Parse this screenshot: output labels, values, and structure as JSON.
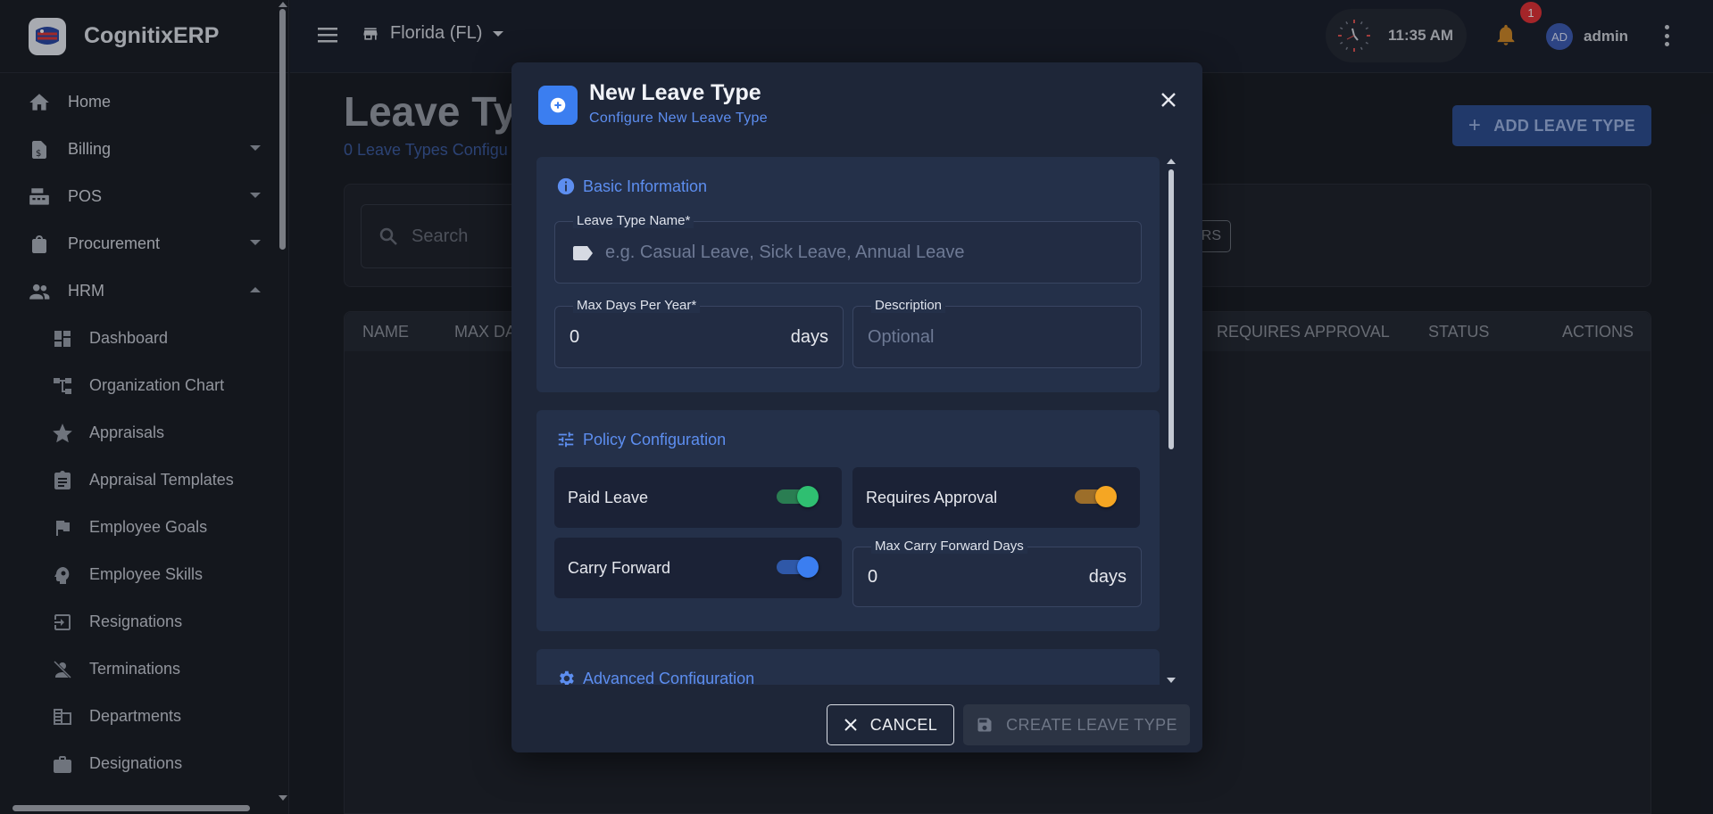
{
  "app": {
    "name": "CognitixERP"
  },
  "sidebar": {
    "items": [
      {
        "label": "Home",
        "icon": "home-icon"
      },
      {
        "label": "Billing",
        "icon": "billing-icon",
        "expandable": true
      },
      {
        "label": "POS",
        "icon": "pos-icon",
        "expandable": true
      },
      {
        "label": "Procurement",
        "icon": "bag-icon",
        "expandable": true
      },
      {
        "label": "HRM",
        "icon": "people-icon",
        "expanded": true
      }
    ],
    "hrm_items": [
      {
        "label": "Dashboard",
        "icon": "dashboard-icon"
      },
      {
        "label": "Organization Chart",
        "icon": "org-chart-icon"
      },
      {
        "label": "Appraisals",
        "icon": "star-icon"
      },
      {
        "label": "Appraisal Templates",
        "icon": "clipboard-icon"
      },
      {
        "label": "Employee Goals",
        "icon": "flag-icon"
      },
      {
        "label": "Employee Skills",
        "icon": "brain-icon"
      },
      {
        "label": "Resignations",
        "icon": "exit-icon"
      },
      {
        "label": "Terminations",
        "icon": "person-off-icon"
      },
      {
        "label": "Departments",
        "icon": "building-icon"
      },
      {
        "label": "Designations",
        "icon": "briefcase-icon"
      }
    ]
  },
  "topbar": {
    "store": "Florida (FL)",
    "time": "11:35 AM",
    "notification_count": "1",
    "user_initials": "AD",
    "user_name": "admin"
  },
  "page": {
    "title": "Leave Ty",
    "subtitle": "0 Leave Types Configu",
    "add_button": "ADD LEAVE TYPE",
    "search_placeholder": "Search",
    "filters_button": "ERS",
    "columns": [
      "NAME",
      "MAX DA",
      "REQUIRES APPROVAL",
      "STATUS",
      "ACTIONS"
    ]
  },
  "modal": {
    "title": "New Leave Type",
    "subtitle": "Configure New Leave Type",
    "basic": {
      "heading": "Basic Information",
      "name_label": "Leave Type Name*",
      "name_placeholder": "e.g. Casual Leave, Sick Leave, Annual Leave",
      "max_days_label": "Max Days Per Year*",
      "max_days_value": "0",
      "max_days_unit": "days",
      "description_label": "Description",
      "description_placeholder": "Optional"
    },
    "policy": {
      "heading": "Policy Configuration",
      "paid_leave": "Paid Leave",
      "requires_approval": "Requires Approval",
      "carry_forward": "Carry Forward",
      "max_carry_label": "Max Carry Forward Days",
      "max_carry_value": "0",
      "max_carry_unit": "days",
      "paid_leave_on": true,
      "requires_approval_on": true,
      "carry_forward_on": true
    },
    "advanced": {
      "heading": "Advanced Configuration"
    },
    "cancel": "CANCEL",
    "create": "CREATE LEAVE TYPE"
  },
  "colors": {
    "accent": "#3b7ef0",
    "toggle_green": "#2fbf71",
    "toggle_orange": "#f5a623",
    "toggle_blue": "#3b7ef0"
  }
}
